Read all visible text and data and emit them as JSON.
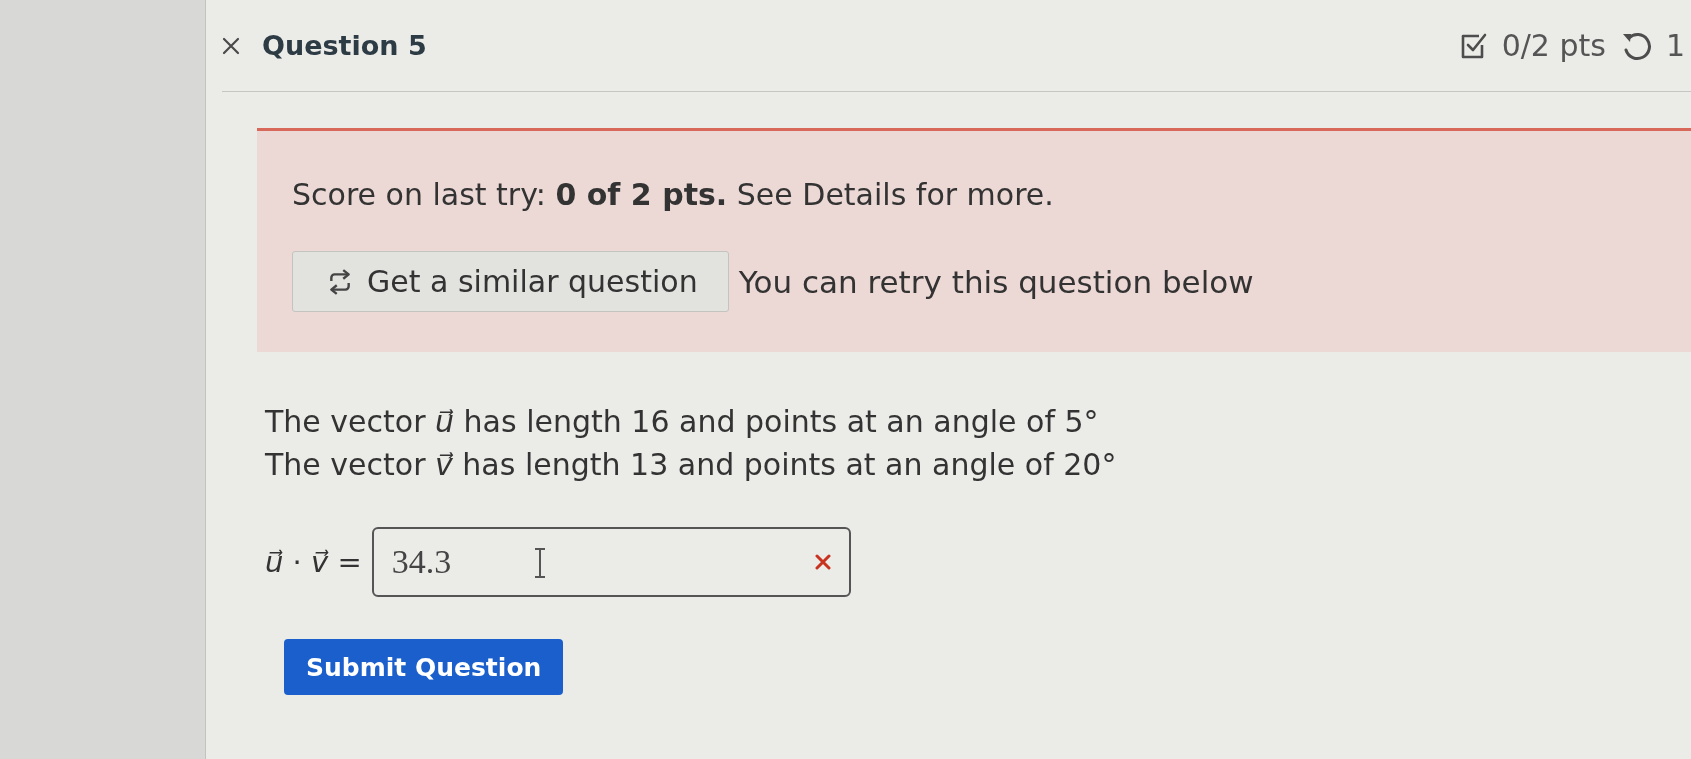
{
  "question": {
    "correct": false,
    "title": "Question 5",
    "points": "0/2 pts",
    "attempts": "1"
  },
  "feedback": {
    "score_text": "Score on last try: **0 of 2 pts.** See Details for more.",
    "similar_button": "Get a similar question",
    "retry_note": "You can retry this question below"
  },
  "prompt": {
    "lines": [
      "The vector *u⃗* has length 16 and points at an angle of 5°",
      "The vector *v⃗* has length 13 and points at an angle of 20°"
    ]
  },
  "answer": {
    "label": "*u⃗* · *v⃗* =",
    "value": "34.3",
    "correct": false
  },
  "submit_button": "Submit Question"
}
